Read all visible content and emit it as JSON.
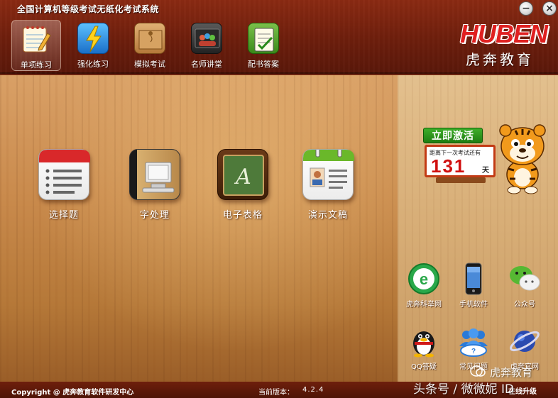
{
  "window": {
    "title": "全国计算机等级考试无纸化考试系统",
    "minimize_glyph": "−",
    "close_glyph": "×"
  },
  "tabs": [
    {
      "label": "单项练习",
      "icon": "notepad-pencil-icon",
      "active": true
    },
    {
      "label": "强化练习",
      "icon": "lightning-icon",
      "active": false
    },
    {
      "label": "模拟考试",
      "icon": "envelope-folder-icon",
      "active": false
    },
    {
      "label": "名师讲堂",
      "icon": "lecture-video-icon",
      "active": false
    },
    {
      "label": "配书答案",
      "icon": "checklist-clipboard-icon",
      "active": false
    }
  ],
  "logo": {
    "text": "HUBEN",
    "chinese": "虎奔教育"
  },
  "modules": [
    {
      "label": "选择题",
      "icon": "list-icon"
    },
    {
      "label": "字处理",
      "icon": "computer-book-icon"
    },
    {
      "label": "电子表格",
      "icon": "framed-letter-icon"
    },
    {
      "label": "演示文稿",
      "icon": "calendar-contact-icon"
    }
  ],
  "activation": {
    "badge": "立即激活",
    "caption": "距离下一次考试还有",
    "days": "131",
    "unit": "天"
  },
  "shortcuts": [
    {
      "label": "虎奔科举网",
      "icon": "e-globe-icon"
    },
    {
      "label": "手机软件",
      "icon": "smartphone-icon"
    },
    {
      "label": "公众号",
      "icon": "wechat-icon"
    },
    {
      "label": "QQ答疑",
      "icon": "qq-penguin-icon"
    },
    {
      "label": "常见问题",
      "icon": "users-question-icon"
    },
    {
      "label": "虎奔官网",
      "icon": "planet-icon"
    }
  ],
  "footer": {
    "copyright": "Copyright @ 虎奔教育软件研发中心",
    "version_label": "当前版本：",
    "version": "4.2.4",
    "upgrade": "在线升级"
  },
  "watermark": {
    "top": "虎奔教育",
    "bottom": "头条号 / 微微妮 ID"
  },
  "colors": {
    "header": "#7a240f",
    "footer": "#5a1708",
    "wood": "#c98a4c",
    "accent_red": "#d01010",
    "activate_green": "#2a9a1c"
  }
}
